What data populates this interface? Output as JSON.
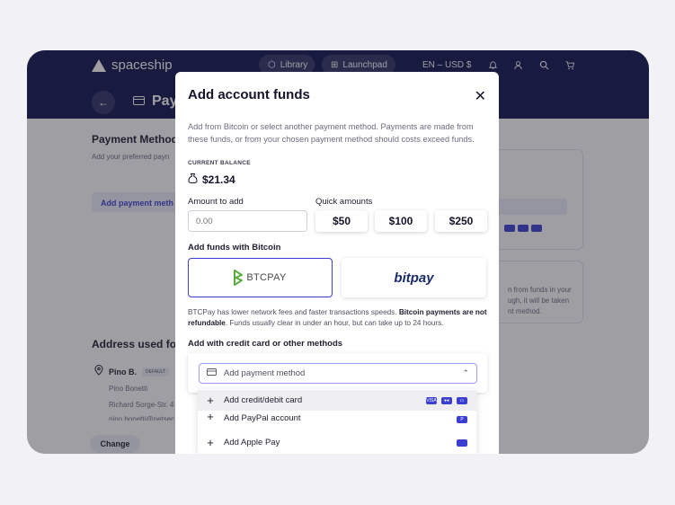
{
  "app": {
    "brand": "spaceship",
    "nav_library": "Library",
    "nav_launchpad": "Launchpad",
    "locale": "EN – USD $",
    "page_title": "Pay"
  },
  "background": {
    "section_payment": "Payment Method",
    "section_payment_sub": "Add your preferred payn",
    "add_payment_link": "Add payment meth",
    "info_text": [
      "n from funds in your",
      "ugh, it will be taken",
      "nt method."
    ],
    "section_address": "Address used for",
    "contact_name": "Pino B.",
    "default_badge": "DEFAULT",
    "address_lines": [
      "Pino Bonetti",
      "Richard Sorge-Str. 4",
      "pino.bonetti@netsec"
    ],
    "change_button": "Change"
  },
  "modal": {
    "title": "Add account funds",
    "description": "Add from Bitcoin or select another payment method. Payments are made from these funds, or from your chosen payment method should costs exceed funds.",
    "balance_label": "CURRENT BALANCE",
    "balance_value": "$21.34",
    "amount_label": "Amount to add",
    "amount_placeholder": "0.00",
    "quick_label": "Quick amounts",
    "quick_amounts": [
      "$50",
      "$100",
      "$250"
    ],
    "bitcoin_label": "Add funds with Bitcoin",
    "btcpay_text": "BTCPAY",
    "bitpay_text": "bitpay",
    "note_start": "BTCPay has lower network fees and faster transactions speeds. ",
    "note_bold": "Bitcoin payments are not refundable",
    "note_end": ". Funds usually clear in under an hour, but can take up to 24 hours.",
    "other_label": "Add with credit card or other methods",
    "dropdown_placeholder": "Add payment method",
    "menu_items": [
      "Add credit/debit card",
      "Add PayPal account",
      "Add Apple Pay"
    ]
  },
  "colors": {
    "topbar": "#0c0f4a",
    "accent": "#3b3fd0"
  }
}
